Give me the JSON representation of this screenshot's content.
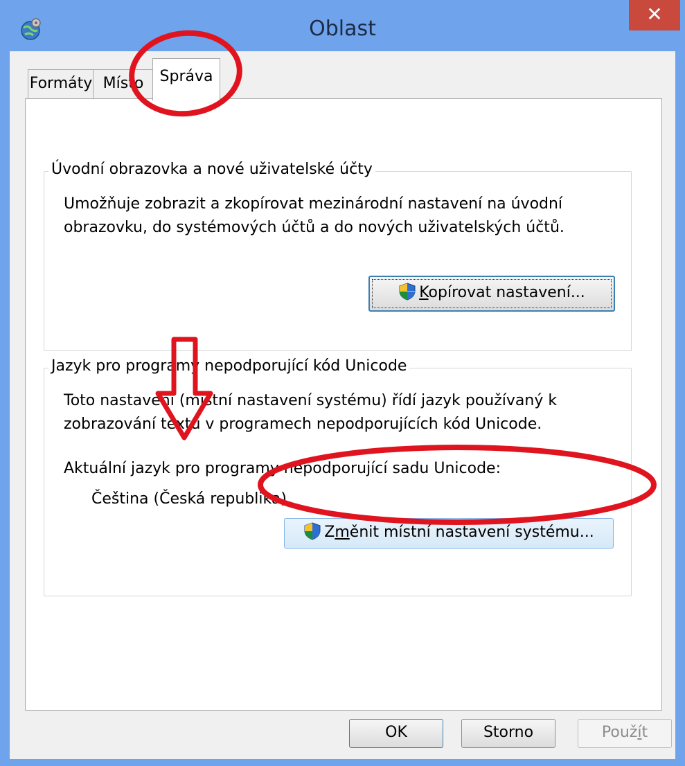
{
  "window": {
    "title": "Oblast",
    "close_glyph": "✕"
  },
  "tabs": [
    {
      "label": "Formáty"
    },
    {
      "label": "Místo"
    },
    {
      "label": "Správa"
    }
  ],
  "welcome_group": {
    "legend": "Úvodní obrazovka a nové uživatelské účty",
    "description_line1": "Umožňuje zobrazit a zkopírovat mezinárodní nastavení na úvodní",
    "description_line2": "obrazovku, do systémových účtů a do nových uživatelských účtů.",
    "copy_button": {
      "prefix": "",
      "accel": "K",
      "rest": "opírovat nastavení..."
    }
  },
  "unicode_group": {
    "legend": "Jazyk pro programy nepodporující kód Unicode",
    "description_line1": "Toto nastavení (místní nastavení systému) řídí jazyk používaný k",
    "description_line2": "zobrazování textu v programech nepodporujících kód Unicode.",
    "current_label": "Aktuální jazyk pro programy nepodporující sadu Unicode:",
    "current_value": "Čeština (Česká republika)",
    "change_button": {
      "prefix": "Z",
      "accel": "m",
      "rest": "ěnit místní nastavení systému..."
    }
  },
  "buttons": {
    "ok": "OK",
    "cancel": "Storno",
    "apply_prefix": "Použ",
    "apply_accel": "í",
    "apply_rest": "t"
  },
  "colors": {
    "title_bar": "#6fa3ec",
    "close_button": "#c94a3d",
    "annotation": "#e0141e"
  },
  "icons": {
    "app": "globe-gear-icon",
    "shield": "uac-shield-icon"
  }
}
